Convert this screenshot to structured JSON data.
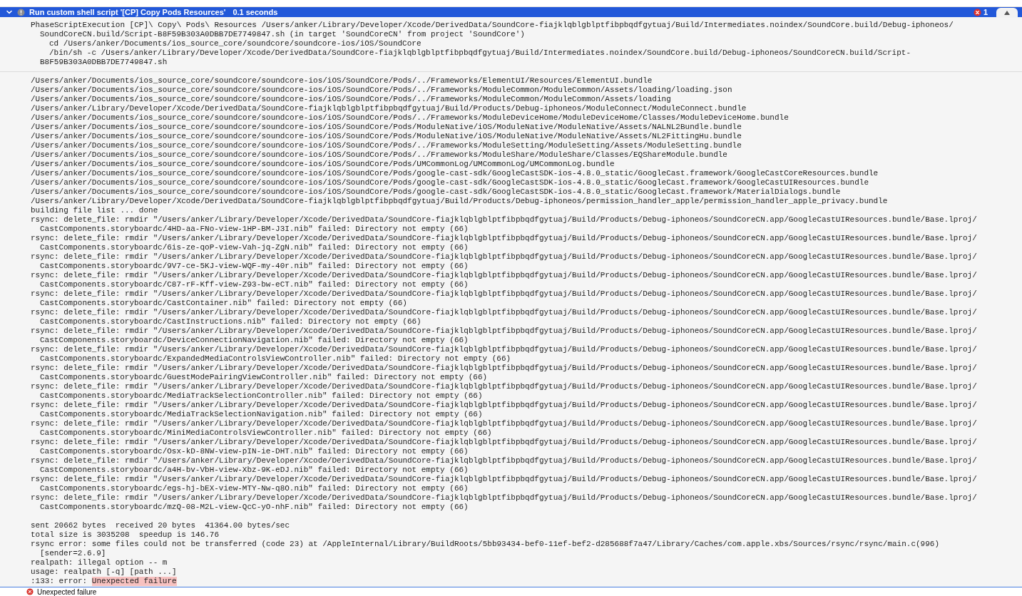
{
  "header": {
    "title": "Run custom shell script '[CP] Copy Pods Resources'",
    "duration": "0.1 seconds",
    "error_count": "1",
    "expanded": true
  },
  "command": [
    {
      "kind": "first",
      "text": "PhaseScriptExecution [CP]\\ Copy\\ Pods\\ Resources /Users/anker/Library/Developer/Xcode/DerivedData/SoundCore-fiajklqblgblptfibpbqdfgytuaj/Build/Intermediates.noindex/SoundCore.build/Debug-iphoneos/"
    },
    {
      "kind": "wrap",
      "text": "SoundCoreCN.build/Script-B8F59B303A0DBB7DE7749847.sh (in target 'SoundCoreCN' from project 'SoundCore')"
    },
    {
      "kind": "sub",
      "text": "cd /Users/anker/Documents/ios_source_core/soundcore/soundcore-ios/iOS/SoundCore"
    },
    {
      "kind": "sub",
      "text": "/bin/sh -c /Users/anker/Library/Developer/Xcode/DerivedData/SoundCore-fiajklqblgblptfibpbqdfgytuaj/Build/Intermediates.noindex/SoundCore.build/Debug-iphoneos/SoundCoreCN.build/Script-"
    },
    {
      "kind": "wrap",
      "text": "B8F59B303A0DBB7DE7749847.sh"
    }
  ],
  "output": [
    {
      "kind": "first",
      "text": "/Users/anker/Documents/ios_source_core/soundcore/soundcore-ios/iOS/SoundCore/Pods/../Frameworks/ElementUI/Resources/ElementUI.bundle"
    },
    {
      "kind": "first",
      "text": "/Users/anker/Documents/ios_source_core/soundcore/soundcore-ios/iOS/SoundCore/Pods/../Frameworks/ModuleCommon/ModuleCommon/Assets/loading/loading.json"
    },
    {
      "kind": "first",
      "text": "/Users/anker/Documents/ios_source_core/soundcore/soundcore-ios/iOS/SoundCore/Pods/../Frameworks/ModuleCommon/ModuleCommon/Assets/loading"
    },
    {
      "kind": "first",
      "text": "/Users/anker/Library/Developer/Xcode/DerivedData/SoundCore-fiajklqblgblptfibpbqdfgytuaj/Build/Products/Debug-iphoneos/ModuleConnect/ModuleConnect.bundle"
    },
    {
      "kind": "first",
      "text": "/Users/anker/Documents/ios_source_core/soundcore/soundcore-ios/iOS/SoundCore/Pods/../Frameworks/ModuleDeviceHome/ModuleDeviceHome/Classes/ModuleDeviceHome.bundle"
    },
    {
      "kind": "first",
      "text": "/Users/anker/Documents/ios_source_core/soundcore/soundcore-ios/iOS/SoundCore/Pods/ModuleNative/iOS/ModuleNative/ModuleNative/Assets/NALNL2Bundle.bundle"
    },
    {
      "kind": "first",
      "text": "/Users/anker/Documents/ios_source_core/soundcore/soundcore-ios/iOS/SoundCore/Pods/ModuleNative/iOS/ModuleNative/ModuleNative/Assets/NL2FittingHu.bundle"
    },
    {
      "kind": "first",
      "text": "/Users/anker/Documents/ios_source_core/soundcore/soundcore-ios/iOS/SoundCore/Pods/../Frameworks/ModuleSetting/ModuleSetting/Assets/ModuleSetting.bundle"
    },
    {
      "kind": "first",
      "text": "/Users/anker/Documents/ios_source_core/soundcore/soundcore-ios/iOS/SoundCore/Pods/../Frameworks/ModuleShare/ModuleShare/Classes/EQShareModule.bundle"
    },
    {
      "kind": "first",
      "text": "/Users/anker/Documents/ios_source_core/soundcore/soundcore-ios/iOS/SoundCore/Pods/UMCommonLog/UMCommonLog/UMCommonLog.bundle"
    },
    {
      "kind": "first",
      "text": "/Users/anker/Documents/ios_source_core/soundcore/soundcore-ios/iOS/SoundCore/Pods/google-cast-sdk/GoogleCastSDK-ios-4.8.0_static/GoogleCast.framework/GoogleCastCoreResources.bundle"
    },
    {
      "kind": "first",
      "text": "/Users/anker/Documents/ios_source_core/soundcore/soundcore-ios/iOS/SoundCore/Pods/google-cast-sdk/GoogleCastSDK-ios-4.8.0_static/GoogleCast.framework/GoogleCastUIResources.bundle"
    },
    {
      "kind": "first",
      "text": "/Users/anker/Documents/ios_source_core/soundcore/soundcore-ios/iOS/SoundCore/Pods/google-cast-sdk/GoogleCastSDK-ios-4.8.0_static/GoogleCast.framework/MaterialDialogs.bundle"
    },
    {
      "kind": "first",
      "text": "/Users/anker/Library/Developer/Xcode/DerivedData/SoundCore-fiajklqblgblptfibpbqdfgytuaj/Build/Products/Debug-iphoneos/permission_handler_apple/permission_handler_apple_privacy.bundle"
    },
    {
      "kind": "first",
      "text": "building file list ... done"
    },
    {
      "kind": "first",
      "text": "rsync: delete_file: rmdir \"/Users/anker/Library/Developer/Xcode/DerivedData/SoundCore-fiajklqblgblptfibpbqdfgytuaj/Build/Products/Debug-iphoneos/SoundCoreCN.app/GoogleCastUIResources.bundle/Base.lproj/"
    },
    {
      "kind": "wrap",
      "text": "CastComponents.storyboardc/4HD-aa-FNo-view-1HP-BM-J3I.nib\" failed: Directory not empty (66)"
    },
    {
      "kind": "first",
      "text": "rsync: delete_file: rmdir \"/Users/anker/Library/Developer/Xcode/DerivedData/SoundCore-fiajklqblgblptfibpbqdfgytuaj/Build/Products/Debug-iphoneos/SoundCoreCN.app/GoogleCastUIResources.bundle/Base.lproj/"
    },
    {
      "kind": "wrap",
      "text": "CastComponents.storyboardc/6is-ze-qoP-view-Vah-jq-ZgN.nib\" failed: Directory not empty (66)"
    },
    {
      "kind": "first",
      "text": "rsync: delete_file: rmdir \"/Users/anker/Library/Developer/Xcode/DerivedData/SoundCore-fiajklqblgblptfibpbqdfgytuaj/Build/Products/Debug-iphoneos/SoundCoreCN.app/GoogleCastUIResources.bundle/Base.lproj/"
    },
    {
      "kind": "wrap",
      "text": "CastComponents.storyboardc/9V7-ce-5KJ-view-WQF-my-40r.nib\" failed: Directory not empty (66)"
    },
    {
      "kind": "first",
      "text": "rsync: delete_file: rmdir \"/Users/anker/Library/Developer/Xcode/DerivedData/SoundCore-fiajklqblgblptfibpbqdfgytuaj/Build/Products/Debug-iphoneos/SoundCoreCN.app/GoogleCastUIResources.bundle/Base.lproj/"
    },
    {
      "kind": "wrap",
      "text": "CastComponents.storyboardc/C87-rF-Kff-view-Z93-bw-eCT.nib\" failed: Directory not empty (66)"
    },
    {
      "kind": "first",
      "text": "rsync: delete_file: rmdir \"/Users/anker/Library/Developer/Xcode/DerivedData/SoundCore-fiajklqblgblptfibpbqdfgytuaj/Build/Products/Debug-iphoneos/SoundCoreCN.app/GoogleCastUIResources.bundle/Base.lproj/"
    },
    {
      "kind": "wrap",
      "text": "CastComponents.storyboardc/CastContainer.nib\" failed: Directory not empty (66)"
    },
    {
      "kind": "first",
      "text": "rsync: delete_file: rmdir \"/Users/anker/Library/Developer/Xcode/DerivedData/SoundCore-fiajklqblgblptfibpbqdfgytuaj/Build/Products/Debug-iphoneos/SoundCoreCN.app/GoogleCastUIResources.bundle/Base.lproj/"
    },
    {
      "kind": "wrap",
      "text": "CastComponents.storyboardc/CastInstructions.nib\" failed: Directory not empty (66)"
    },
    {
      "kind": "first",
      "text": "rsync: delete_file: rmdir \"/Users/anker/Library/Developer/Xcode/DerivedData/SoundCore-fiajklqblgblptfibpbqdfgytuaj/Build/Products/Debug-iphoneos/SoundCoreCN.app/GoogleCastUIResources.bundle/Base.lproj/"
    },
    {
      "kind": "wrap",
      "text": "CastComponents.storyboardc/DeviceConnectionNavigation.nib\" failed: Directory not empty (66)"
    },
    {
      "kind": "first",
      "text": "rsync: delete_file: rmdir \"/Users/anker/Library/Developer/Xcode/DerivedData/SoundCore-fiajklqblgblptfibpbqdfgytuaj/Build/Products/Debug-iphoneos/SoundCoreCN.app/GoogleCastUIResources.bundle/Base.lproj/"
    },
    {
      "kind": "wrap",
      "text": "CastComponents.storyboardc/ExpandedMediaControlsViewController.nib\" failed: Directory not empty (66)"
    },
    {
      "kind": "first",
      "text": "rsync: delete_file: rmdir \"/Users/anker/Library/Developer/Xcode/DerivedData/SoundCore-fiajklqblgblptfibpbqdfgytuaj/Build/Products/Debug-iphoneos/SoundCoreCN.app/GoogleCastUIResources.bundle/Base.lproj/"
    },
    {
      "kind": "wrap",
      "text": "CastComponents.storyboardc/GuestModePairingViewController.nib\" failed: Directory not empty (66)"
    },
    {
      "kind": "first",
      "text": "rsync: delete_file: rmdir \"/Users/anker/Library/Developer/Xcode/DerivedData/SoundCore-fiajklqblgblptfibpbqdfgytuaj/Build/Products/Debug-iphoneos/SoundCoreCN.app/GoogleCastUIResources.bundle/Base.lproj/"
    },
    {
      "kind": "wrap",
      "text": "CastComponents.storyboardc/MediaTrackSelectionController.nib\" failed: Directory not empty (66)"
    },
    {
      "kind": "first",
      "text": "rsync: delete_file: rmdir \"/Users/anker/Library/Developer/Xcode/DerivedData/SoundCore-fiajklqblgblptfibpbqdfgytuaj/Build/Products/Debug-iphoneos/SoundCoreCN.app/GoogleCastUIResources.bundle/Base.lproj/"
    },
    {
      "kind": "wrap",
      "text": "CastComponents.storyboardc/MediaTrackSelectionNavigation.nib\" failed: Directory not empty (66)"
    },
    {
      "kind": "first",
      "text": "rsync: delete_file: rmdir \"/Users/anker/Library/Developer/Xcode/DerivedData/SoundCore-fiajklqblgblptfibpbqdfgytuaj/Build/Products/Debug-iphoneos/SoundCoreCN.app/GoogleCastUIResources.bundle/Base.lproj/"
    },
    {
      "kind": "wrap",
      "text": "CastComponents.storyboardc/MiniMediaControlsViewController.nib\" failed: Directory not empty (66)"
    },
    {
      "kind": "first",
      "text": "rsync: delete_file: rmdir \"/Users/anker/Library/Developer/Xcode/DerivedData/SoundCore-fiajklqblgblptfibpbqdfgytuaj/Build/Products/Debug-iphoneos/SoundCoreCN.app/GoogleCastUIResources.bundle/Base.lproj/"
    },
    {
      "kind": "wrap",
      "text": "CastComponents.storyboardc/Osx-kD-8NW-view-pIN-ie-DHT.nib\" failed: Directory not empty (66)"
    },
    {
      "kind": "first",
      "text": "rsync: delete_file: rmdir \"/Users/anker/Library/Developer/Xcode/DerivedData/SoundCore-fiajklqblgblptfibpbqdfgytuaj/Build/Products/Debug-iphoneos/SoundCoreCN.app/GoogleCastUIResources.bundle/Base.lproj/"
    },
    {
      "kind": "wrap",
      "text": "CastComponents.storyboardc/a4H-bv-VbH-view-Xbz-9K-eDJ.nib\" failed: Directory not empty (66)"
    },
    {
      "kind": "first",
      "text": "rsync: delete_file: rmdir \"/Users/anker/Library/Developer/Xcode/DerivedData/SoundCore-fiajklqblgblptfibpbqdfgytuaj/Build/Products/Debug-iphoneos/SoundCoreCN.app/GoogleCastUIResources.bundle/Base.lproj/"
    },
    {
      "kind": "wrap",
      "text": "CastComponents.storyboardc/egs-hj-bEX-view-MTY-Nw-q8O.nib\" failed: Directory not empty (66)"
    },
    {
      "kind": "first",
      "text": "rsync: delete_file: rmdir \"/Users/anker/Library/Developer/Xcode/DerivedData/SoundCore-fiajklqblgblptfibpbqdfgytuaj/Build/Products/Debug-iphoneos/SoundCoreCN.app/GoogleCastUIResources.bundle/Base.lproj/"
    },
    {
      "kind": "wrap",
      "text": "CastComponents.storyboardc/mzQ-08-M2L-view-QcC-yO-nhF.nib\" failed: Directory not empty (66)"
    }
  ],
  "summary": [
    {
      "kind": "first",
      "text": "sent 20662 bytes  received 20 bytes  41364.00 bytes/sec"
    },
    {
      "kind": "first",
      "text": "total size is 3035208  speedup is 146.76"
    },
    {
      "kind": "first",
      "text": "rsync error: some files could not be transferred (code 23) at /AppleInternal/Library/BuildRoots/5bb93434-bef0-11ef-bef2-d285688f7a47/Library/Caches/com.apple.xbs/Sources/rsync/rsync/main.c(996)"
    },
    {
      "kind": "wrap",
      "text": "[sender=2.6.9]"
    },
    {
      "kind": "first",
      "text": "realpath: illegal option -- m"
    },
    {
      "kind": "first",
      "text": "usage: realpath [-q] [path ...]"
    },
    {
      "kind": "error",
      "text": ":133: error: ",
      "highlight": "Unexpected failure"
    }
  ],
  "issue": {
    "text": "Unexpected failure"
  }
}
